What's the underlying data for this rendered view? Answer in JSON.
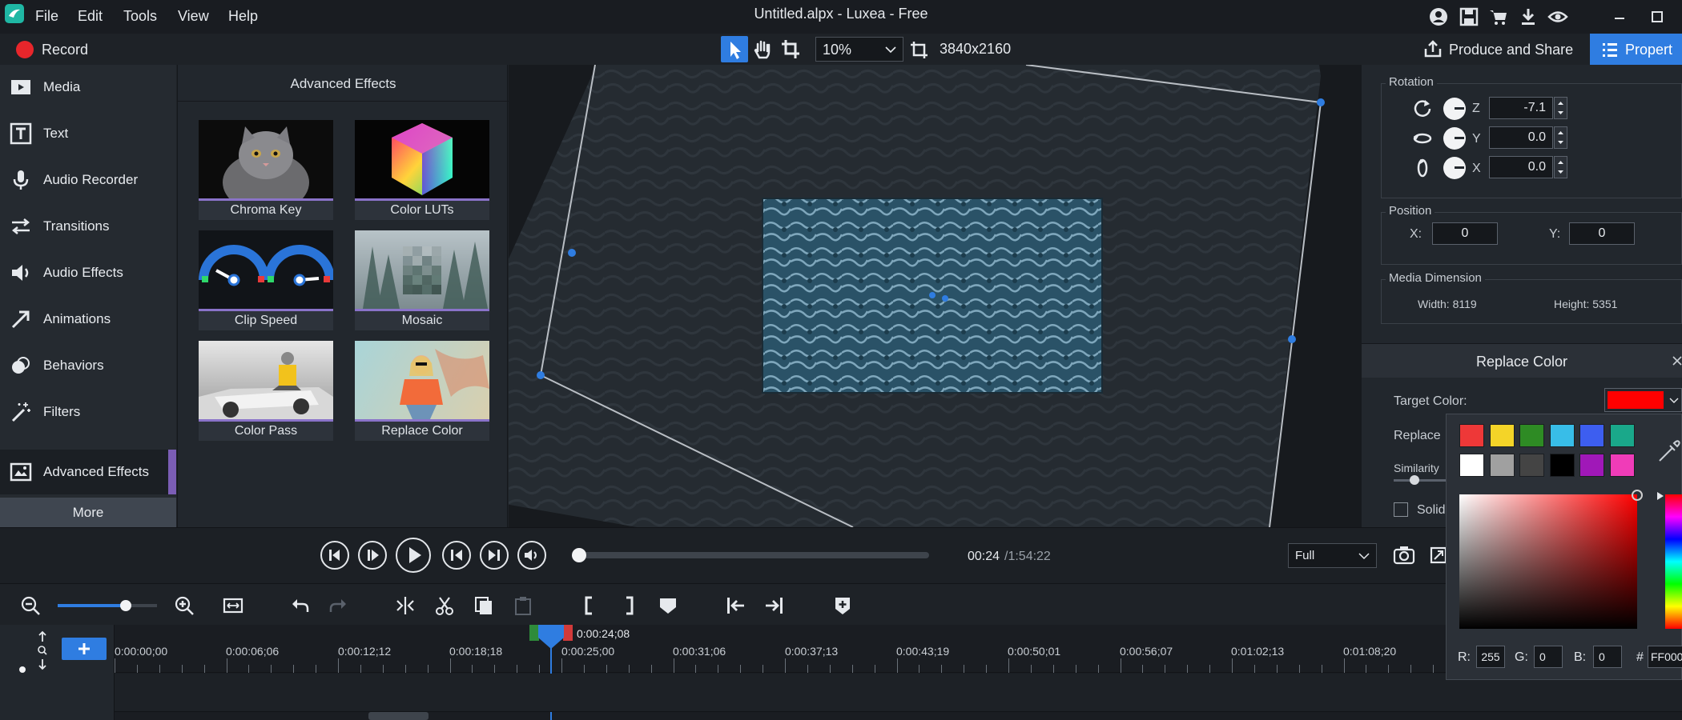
{
  "menu": {
    "items": [
      "File",
      "Edit",
      "Tools",
      "View",
      "Help"
    ],
    "title": "Untitled.alpx - Luxea - Free"
  },
  "toolbar": {
    "record_label": "Record",
    "zoom_value": "10%",
    "resolution": "3840x2160",
    "produce_label": "Produce and Share",
    "properties_label": "Propert"
  },
  "sidebar": {
    "items": [
      {
        "label": "Media",
        "icon": "media-icon"
      },
      {
        "label": "Text",
        "icon": "text-icon"
      },
      {
        "label": "Audio Recorder",
        "icon": "microphone-icon"
      },
      {
        "label": "Transitions",
        "icon": "transitions-icon"
      },
      {
        "label": "Audio Effects",
        "icon": "speaker-icon"
      },
      {
        "label": "Animations",
        "icon": "arrow-icon"
      },
      {
        "label": "Behaviors",
        "icon": "behaviors-icon"
      },
      {
        "label": "Filters",
        "icon": "wand-icon"
      },
      {
        "label": "Advanced Effects",
        "icon": "advanced-effects-icon"
      }
    ],
    "more_label": "More"
  },
  "effects": {
    "title": "Advanced Effects",
    "cards": [
      "Chroma Key",
      "Color LUTs",
      "Clip Speed",
      "Mosaic",
      "Color Pass",
      "Replace Color"
    ]
  },
  "properties": {
    "rotation_title": "Rotation",
    "rotation": [
      {
        "axis": "Z",
        "value": "-7.1"
      },
      {
        "axis": "Y",
        "value": "0.0"
      },
      {
        "axis": "X",
        "value": "0.0"
      }
    ],
    "position_title": "Position",
    "position_x_label": "X:",
    "position_x": "0",
    "position_y_label": "Y:",
    "position_y": "0",
    "media_dimension_title": "Media Dimension",
    "width_text": "Width: 8119",
    "height_text": "Height: 5351",
    "replace_color_title": "Replace Color",
    "target_color_label": "Target Color:",
    "target_color": "#ff0000",
    "replace_label": "Replace",
    "similarity_label": "Similarity",
    "solid_label": "Solid"
  },
  "player": {
    "time_current": "00:24",
    "time_total": "/1:54:22",
    "view_mode": "Full",
    "progress": 0.0
  },
  "timeline": {
    "playhead_time": "0:00:24;08",
    "ruler": [
      "0:00:00;00",
      "0:00:06;06",
      "0:00:12;12",
      "0:00:18;18",
      "0:00:25;00",
      "0:00:31;06",
      "0:00:37;13",
      "0:00:43;19",
      "0:00:50;01",
      "0:00:56;07",
      "0:01:02;13",
      "0:01:08;20"
    ]
  },
  "color_picker": {
    "swatches": [
      "#ee3838",
      "#f4d428",
      "#2e8b24",
      "#38bde8",
      "#3d5ef0",
      "#1aa88a",
      "#ffffff",
      "#a0a0a0",
      "#444444",
      "#000000",
      "#a018b8",
      "#f03cb8"
    ],
    "r_label": "R:",
    "r": "255",
    "g_label": "G:",
    "g": "0",
    "b_label": "B:",
    "b": "0",
    "hex_label": "#",
    "hex": "FF000"
  },
  "colors": {
    "accent": "#2f7de1",
    "record_red": "#e8262b",
    "active_bar": "#7b5db5"
  }
}
